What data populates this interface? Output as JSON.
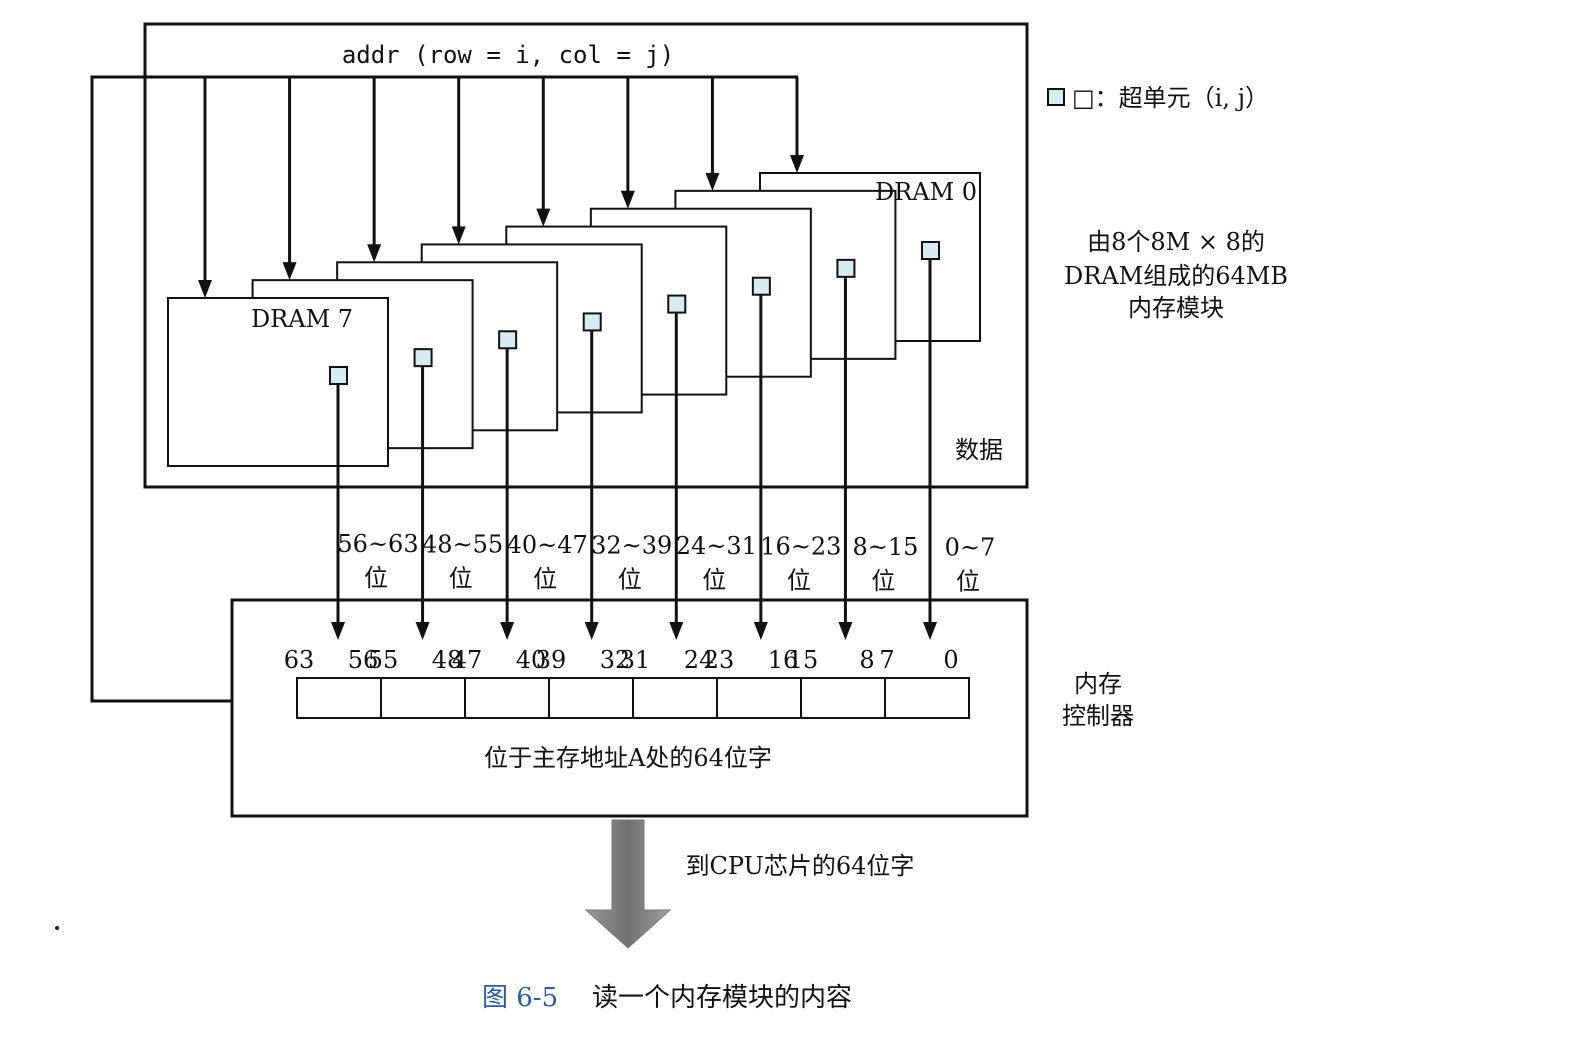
{
  "addr_label": "addr (row = i, col = j)",
  "legend": "□：超单元（i, j）",
  "module_label": [
    "由8个8M × 8的",
    "DRAM组成的64MB",
    "内存模块"
  ],
  "dram_first_label": "DRAM 0",
  "dram_last_label": "DRAM 7",
  "data_label": "数据",
  "bit_ranges": [
    {
      "range": "56~63",
      "unit": "位"
    },
    {
      "range": "48~55",
      "unit": "位"
    },
    {
      "range": "40~47",
      "unit": "位"
    },
    {
      "range": "32~39",
      "unit": "位"
    },
    {
      "range": "24~31",
      "unit": "位"
    },
    {
      "range": "16~23",
      "unit": "位"
    },
    {
      "range": "8~15",
      "unit": "位"
    },
    {
      "range": "0~7",
      "unit": "位"
    }
  ],
  "bit_numbers": [
    "63",
    "56",
    "55",
    "48",
    "47",
    "40",
    "39",
    "32",
    "31",
    "24",
    "23",
    "16",
    "15",
    "8",
    "7",
    "0"
  ],
  "word_label": "位于主存地址A处的64位字",
  "controller_label": [
    "内存",
    "控制器"
  ],
  "cpu_label": "到CPU芯片的64位字",
  "caption": {
    "number": "图 6-5",
    "text": "读一个内存模块的内容"
  },
  "colors": {
    "line": "#111111",
    "supercell": "#d6ecf3",
    "caption": "#2b5aa6",
    "arrow_gray": "#888888"
  }
}
